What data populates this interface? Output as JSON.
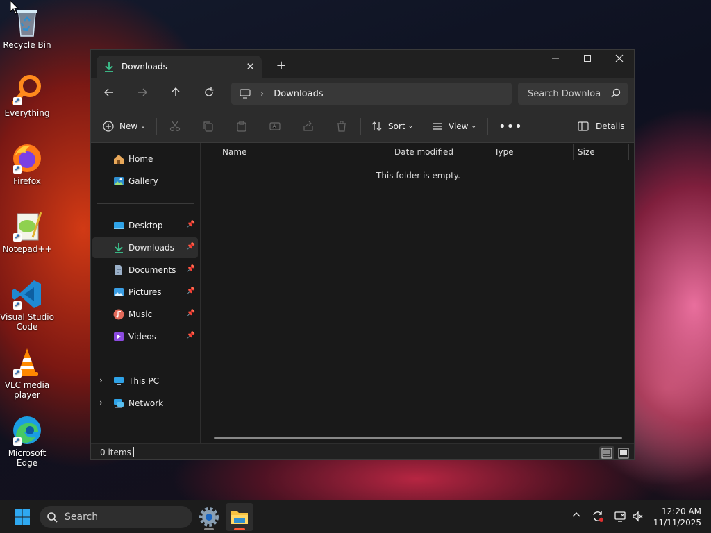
{
  "desktop": {
    "icons": [
      {
        "label": "Recycle Bin",
        "icon": "recycle-bin-icon"
      },
      {
        "label": "Everything",
        "icon": "everything-search-icon"
      },
      {
        "label": "Firefox",
        "icon": "firefox-icon"
      },
      {
        "label": "Notepad++",
        "icon": "notepad-plus-plus-icon"
      },
      {
        "label": "Visual Studio Code",
        "icon": "vscode-icon"
      },
      {
        "label": "VLC media player",
        "icon": "vlc-icon"
      },
      {
        "label": "Microsoft Edge",
        "icon": "edge-icon"
      }
    ]
  },
  "explorer": {
    "tab_title": "Downloads",
    "address": {
      "location": "Downloads"
    },
    "search": {
      "placeholder": "Search Downloa"
    },
    "toolbar": {
      "new_label": "New",
      "sort_label": "Sort",
      "view_label": "View",
      "details_label": "Details"
    },
    "sidebar": {
      "top_items": [
        {
          "label": "Home",
          "icon": "home-icon"
        },
        {
          "label": "Gallery",
          "icon": "gallery-icon"
        }
      ],
      "quick_access": [
        {
          "label": "Desktop",
          "icon": "desktop-folder-icon",
          "pinned": true
        },
        {
          "label": "Downloads",
          "icon": "download-icon",
          "pinned": true,
          "selected": true
        },
        {
          "label": "Documents",
          "icon": "documents-icon",
          "pinned": true
        },
        {
          "label": "Pictures",
          "icon": "pictures-icon",
          "pinned": true
        },
        {
          "label": "Music",
          "icon": "music-icon",
          "pinned": true
        },
        {
          "label": "Videos",
          "icon": "videos-icon",
          "pinned": true
        }
      ],
      "locations": [
        {
          "label": "This PC",
          "icon": "this-pc-icon"
        },
        {
          "label": "Network",
          "icon": "network-icon"
        }
      ]
    },
    "columns": [
      "Name",
      "Date modified",
      "Type",
      "Size"
    ],
    "empty_message": "This folder is empty.",
    "status": {
      "items_text": "0 items"
    }
  },
  "taskbar": {
    "search_label": "Search",
    "clock": {
      "time": "12:20 AM",
      "date": "11/11/2025"
    }
  },
  "colors": {
    "accent_download": "#3cc48e",
    "window_bg": "#191919",
    "toolbar_bg": "#2c2c2c",
    "taskbar_bg": "#1c1c1c"
  }
}
